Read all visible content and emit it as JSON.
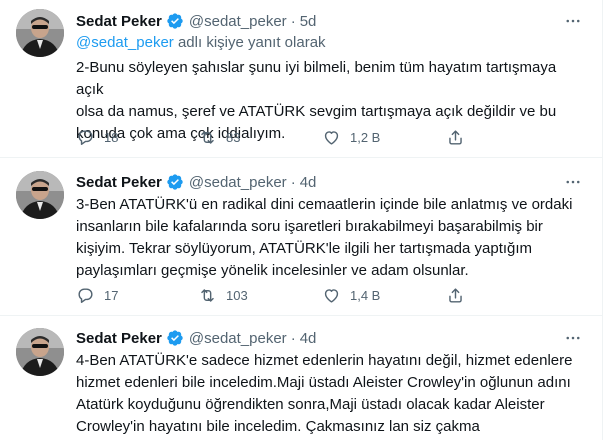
{
  "tweets": [
    {
      "name": "Sedat Peker",
      "handle": "@sedat_peker",
      "separator": "·",
      "time": "5d",
      "reply_mention": "@sedat_peker",
      "reply_suffix": " adlı kişiye yanıt olarak",
      "text": "2-Bunu söyleyen şahıslar şunu iyi bilmeli, benim tüm hayatım tartışmaya açık\nolsa da namus, şeref ve ATATÜRK sevgim tartışmaya açık değildir ve bu\nkonuda çok ama çok iddialıyım.",
      "replies": "18",
      "retweets": "83",
      "likes": "1,2 B"
    },
    {
      "name": "Sedat Peker",
      "handle": "@sedat_peker",
      "separator": "·",
      "time": "4d",
      "text": "3-Ben ATATÜRK'ü en radikal dini cemaatlerin içinde bile anlatmış ve ordaki\ninsanların bile kafalarında soru işaretleri bırakabilmeyi başarabilmiş bir\nkişiyim. Tekrar söylüyorum, ATATÜRK'le ilgili her tartışmada yaptığım\npaylaşımları geçmişe yönelik incelesinler ve adam olsunlar.",
      "replies": "17",
      "retweets": "103",
      "likes": "1,4 B"
    },
    {
      "name": "Sedat Peker",
      "handle": "@sedat_peker",
      "separator": "·",
      "time": "4d",
      "text": "4-Ben ATATÜRK'e sadece hizmet edenlerin hayatını değil, hizmet edenlere\nhizmet edenleri bile inceledim.Maji üstadı Aleister Crowley'in oğlunun adını\nAtatürk koyduğunu öğrendikten sonra,Maji üstadı olacak kadar Aleister\nCrowley'in hayatını bile inceledim. Çakmasınız lan siz çakma"
    }
  ],
  "icons": {
    "verified": "verified-badge-icon",
    "more": "more-icon",
    "reply": "reply-icon",
    "retweet": "retweet-icon",
    "like": "like-icon",
    "share": "share-icon"
  },
  "colors": {
    "accent": "#1d9bf0",
    "secondary_text": "#536471",
    "primary_text": "#0f1419",
    "divider": "#eff3f4"
  }
}
